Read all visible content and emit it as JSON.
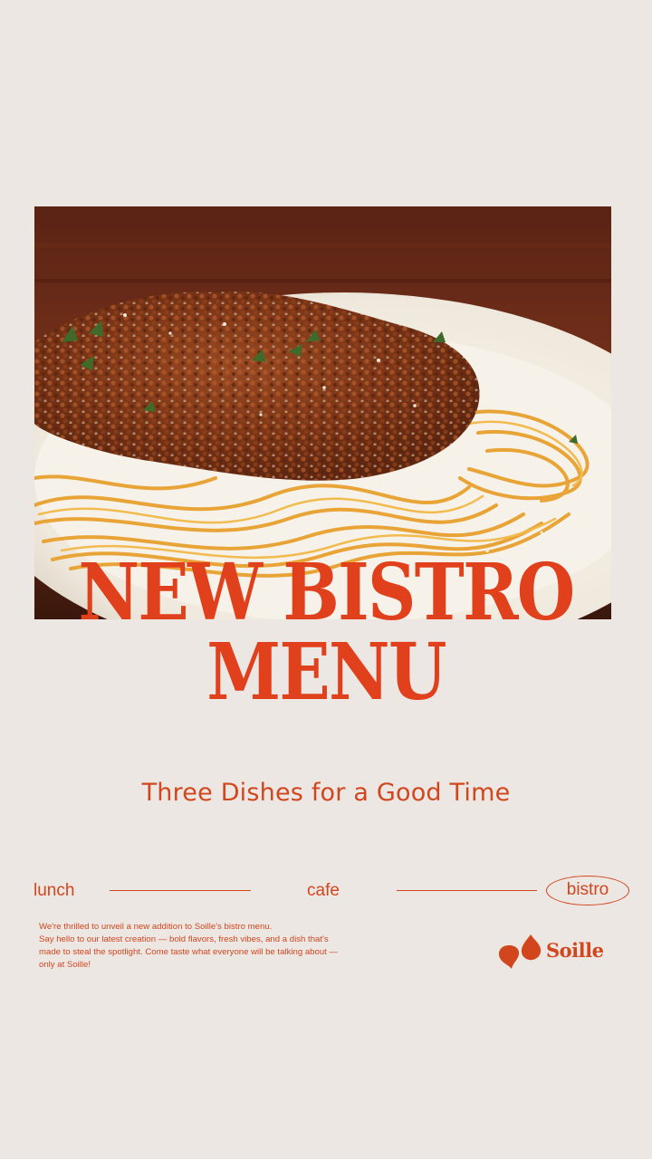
{
  "headline": {
    "line1": "NEW BISTRO",
    "line2": "MENU"
  },
  "subtitle": "Three Dishes for a Good Time",
  "nav": {
    "items": [
      "lunch",
      "cafe",
      "bistro"
    ],
    "active": "bistro"
  },
  "description": {
    "lines": [
      "We're thrilled to unveil a new addition to Soille's bistro menu.",
      "Say hello to our latest creation — bold flavors, fresh vibes, and a dish that's",
      "made to steal the spotlight. Come taste what everyone will be talking about —",
      "only at Soille!"
    ]
  },
  "brand": {
    "name": "Soille"
  },
  "photo": {
    "subject": "spaghetti bolognese on white plate"
  },
  "colors": {
    "background": "#ece7e3",
    "accent": "#e0401c",
    "text": "#d2461e"
  }
}
